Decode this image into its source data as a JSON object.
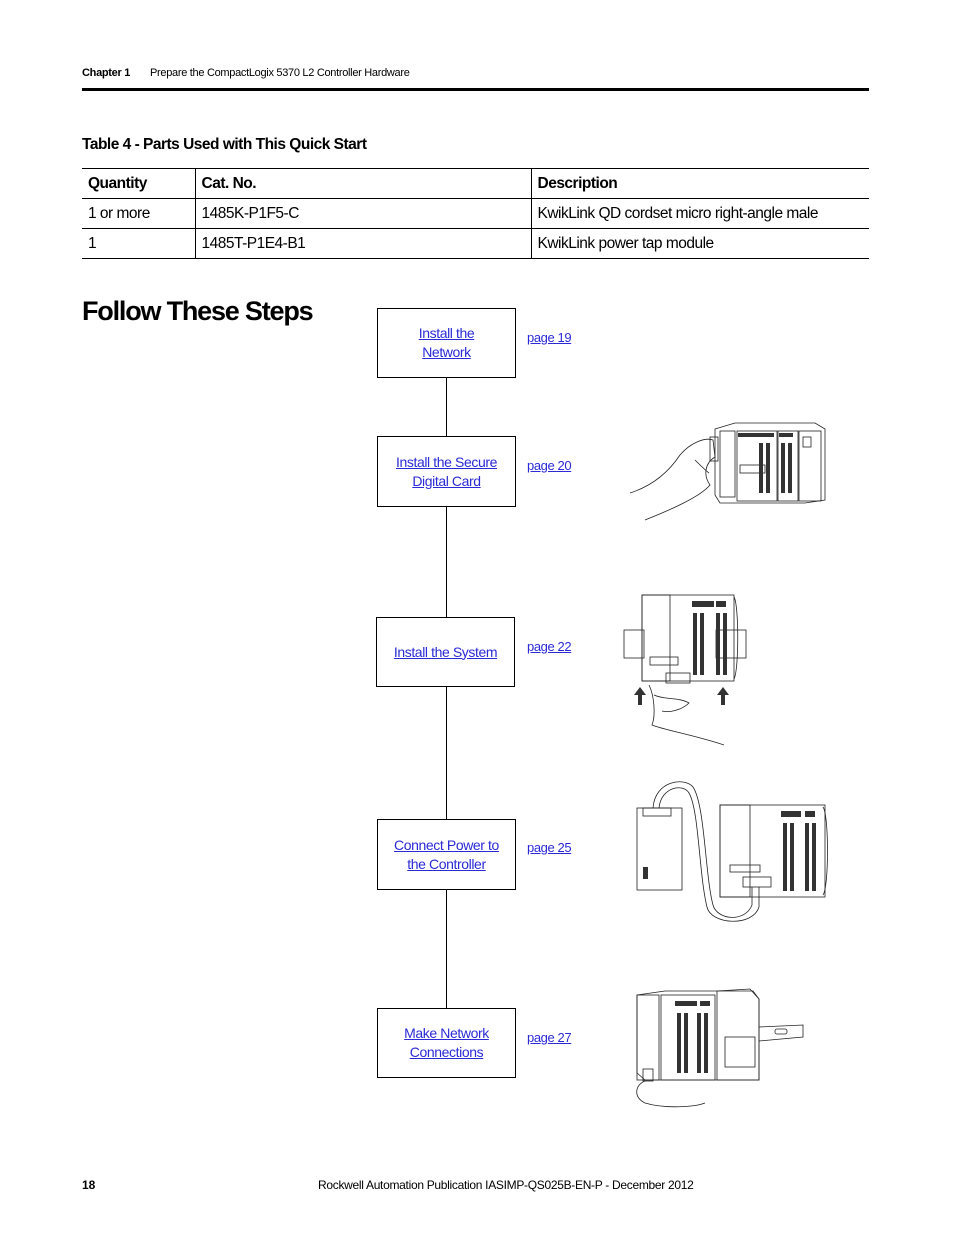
{
  "header": {
    "chapter": "Chapter 1",
    "title": "Prepare the CompactLogix 5370 L2 Controller Hardware"
  },
  "table": {
    "caption": "Table 4 - Parts Used with This Quick Start",
    "columns": [
      "Quantity",
      "Cat. No.",
      "Description"
    ],
    "rows": [
      [
        "1 or more",
        "1485K-P1F5-C",
        "KwikLink QD cordset micro right-angle male"
      ],
      [
        "1",
        "1485T-P1E4-B1",
        "KwikLink power tap module"
      ]
    ]
  },
  "section": {
    "title": "Follow These Steps"
  },
  "steps": [
    {
      "label": "Install the \nNetwork",
      "page": "page 19",
      "illustration": "none"
    },
    {
      "label": "Install the Secure \nDigital Card",
      "page": "page 20",
      "illustration": "hand-inserting-sd-card-into-controller"
    },
    {
      "label": "Install the System",
      "page": "page 22",
      "illustration": "controller-mounted-on-din-rail-with-arrows"
    },
    {
      "label": "Connect Power to \nthe Controller",
      "page": "page 25",
      "illustration": "power-supply-wired-to-controller"
    },
    {
      "label": "Make Network \nConnections",
      "page": "page 27",
      "illustration": "hand-connecting-network-cable"
    }
  ],
  "footer": {
    "page_number": "18",
    "publication": "Rockwell Automation Publication IASIMP-QS025B-EN-P - December 2012"
  },
  "colors": {
    "link": "#2a2ad6",
    "text": "#000000"
  }
}
